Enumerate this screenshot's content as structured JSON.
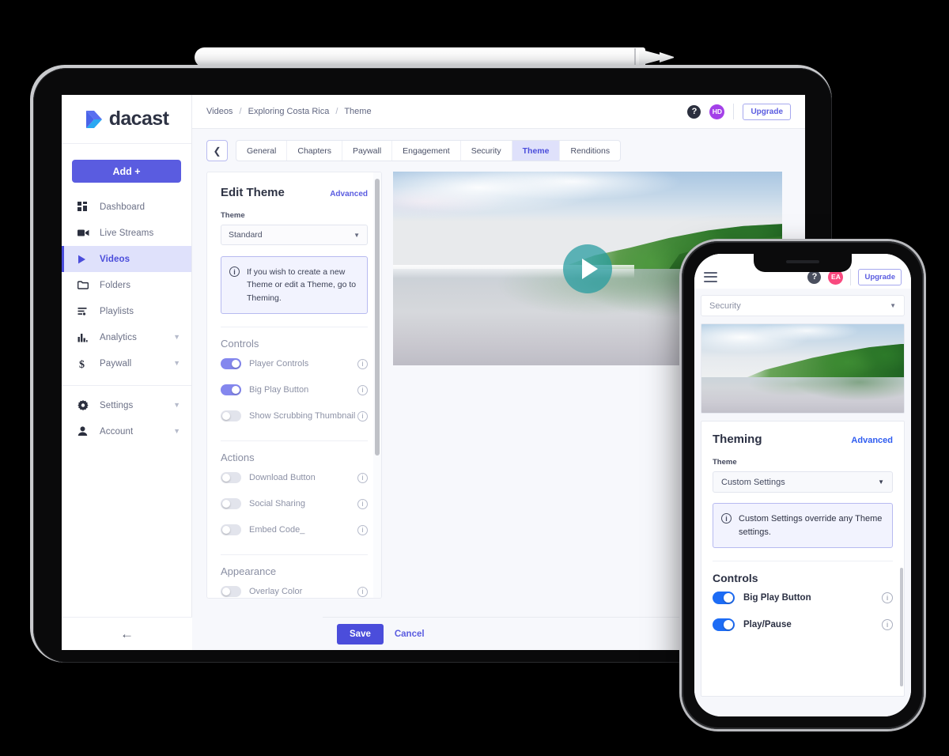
{
  "brand": {
    "logo_text": "dacast",
    "accent": "#5a5ce0",
    "accent_light": "#8487ee",
    "phone_accent": "#1d6cf5"
  },
  "tablet": {
    "sidebar": {
      "add_button": "Add +",
      "items": [
        {
          "label": "Dashboard",
          "icon": "dashboard-icon",
          "active": false,
          "chevron": false
        },
        {
          "label": "Live Streams",
          "icon": "video-camera-icon",
          "active": false,
          "chevron": false
        },
        {
          "label": "Videos",
          "icon": "play-icon",
          "active": true,
          "chevron": false
        },
        {
          "label": "Folders",
          "icon": "folder-icon",
          "active": false,
          "chevron": false
        },
        {
          "label": "Playlists",
          "icon": "playlist-icon",
          "active": false,
          "chevron": false
        },
        {
          "label": "Analytics",
          "icon": "bar-chart-icon",
          "active": false,
          "chevron": true
        },
        {
          "label": "Paywall",
          "icon": "dollar-icon",
          "active": false,
          "chevron": true
        }
      ],
      "items_secondary": [
        {
          "label": "Settings",
          "icon": "gear-icon",
          "chevron": true
        },
        {
          "label": "Account",
          "icon": "person-icon",
          "chevron": true
        }
      ],
      "collapse_icon": "arrow-left-icon"
    },
    "topbar": {
      "breadcrumb": [
        "Videos",
        "Exploring Costa Rica",
        "Theme"
      ],
      "separator": "/",
      "help_label": "?",
      "avatar_initials": "HD",
      "avatar_color": "#a340e8",
      "upgrade_label": "Upgrade"
    },
    "tabs": {
      "back_icon": "chevron-left-icon",
      "items": [
        {
          "label": "General",
          "active": false
        },
        {
          "label": "Chapters",
          "active": false
        },
        {
          "label": "Paywall",
          "active": false
        },
        {
          "label": "Engagement",
          "active": false
        },
        {
          "label": "Security",
          "active": false
        },
        {
          "label": "Theme",
          "active": true
        },
        {
          "label": "Renditions",
          "active": false
        }
      ]
    },
    "theme_panel": {
      "title": "Edit Theme",
      "advanced_label": "Advanced",
      "theme_field_label": "Theme",
      "theme_value": "Standard",
      "note": "If you wish to create a new Theme or edit a Theme, go to Theming.",
      "sections": [
        {
          "title": "Controls",
          "toggles": [
            {
              "label": "Player Controls",
              "on": true
            },
            {
              "label": "Big Play Button",
              "on": true
            },
            {
              "label": "Show Scrubbing Thumbnail",
              "on": false
            }
          ]
        },
        {
          "title": "Actions",
          "toggles": [
            {
              "label": "Download Button",
              "on": false
            },
            {
              "label": "Social Sharing",
              "on": false
            },
            {
              "label": "Embed Code_",
              "on": false
            }
          ]
        },
        {
          "title": "Appearance",
          "toggles": [
            {
              "label": "Overlay Color",
              "on": false
            }
          ]
        }
      ]
    },
    "video_preview": {
      "play_icon": "play-triangle-icon",
      "play_circle_color": "#239ba0"
    },
    "footer": {
      "save_label": "Save",
      "cancel_label": "Cancel"
    }
  },
  "phone": {
    "topbar": {
      "menu_icon": "hamburger-menu-icon",
      "help_label": "?",
      "avatar_initials": "EA",
      "avatar_color": "#f9497f",
      "upgrade_label": "Upgrade"
    },
    "page_select_value": "Security",
    "theme_panel": {
      "title": "Theming",
      "advanced_label": "Advanced",
      "theme_field_label": "Theme",
      "theme_value": "Custom Settings",
      "note": "Custom Settings override any Theme settings.",
      "sections": [
        {
          "title": "Controls",
          "toggles": [
            {
              "label": "Big Play Button",
              "on": true
            },
            {
              "label": "Play/Pause",
              "on": true
            }
          ]
        }
      ]
    }
  }
}
